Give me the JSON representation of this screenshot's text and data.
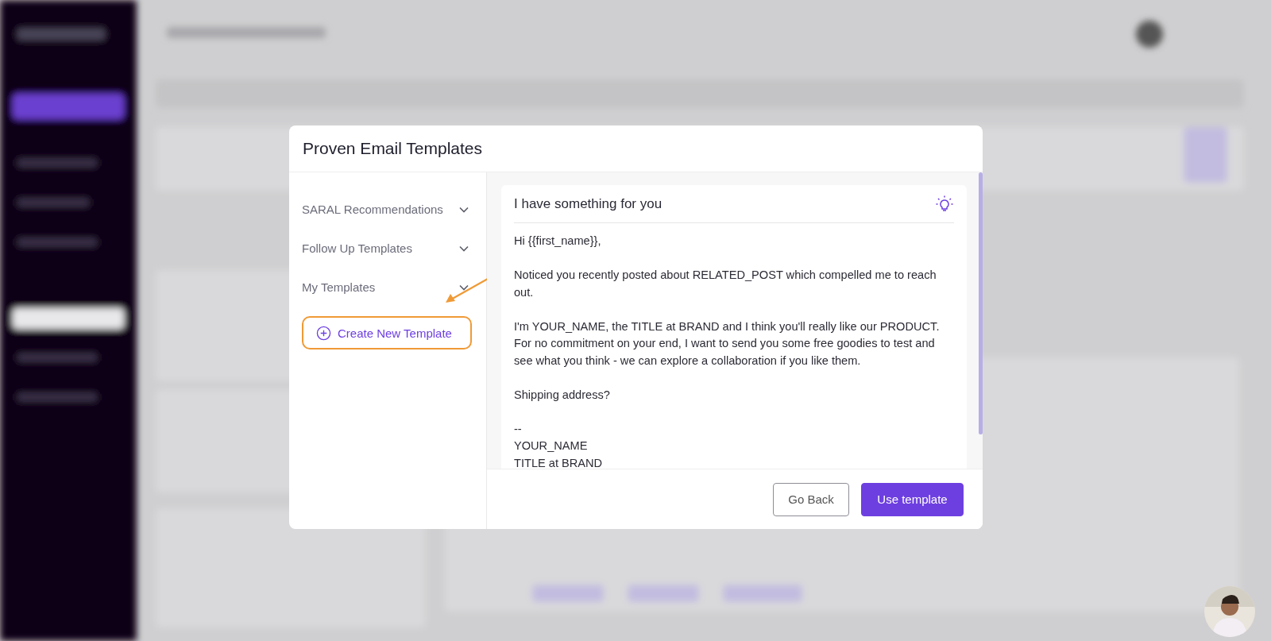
{
  "modal": {
    "title": "Proven Email Templates",
    "categories": [
      {
        "label": "SARAL Recommendations",
        "expanded": false
      },
      {
        "label": "Follow Up Templates",
        "expanded": false
      },
      {
        "label": "My Templates",
        "expanded": false
      }
    ],
    "create_button": {
      "label": "Create New Template",
      "highlighted": true
    },
    "template": {
      "title": "I have something for you",
      "paragraphs": [
        [
          "Hi {{first_name}},"
        ],
        [
          "Noticed you recently posted about RELATED_POST which compelled me to reach out."
        ],
        [
          "I'm YOUR_NAME, the TITLE at BRAND and I think you'll really like our PRODUCT.",
          "For no commitment on your end, I want to send you some free goodies to test and see what you think - we can explore a collaboration if you like them."
        ],
        [
          "Shipping address?"
        ],
        [
          "--",
          "YOUR_NAME",
          "TITLE at BRAND"
        ]
      ]
    },
    "buttons": [
      {
        "label": "Go Back",
        "kind": "secondary"
      },
      {
        "label": "Use template",
        "kind": "primary"
      }
    ]
  }
}
